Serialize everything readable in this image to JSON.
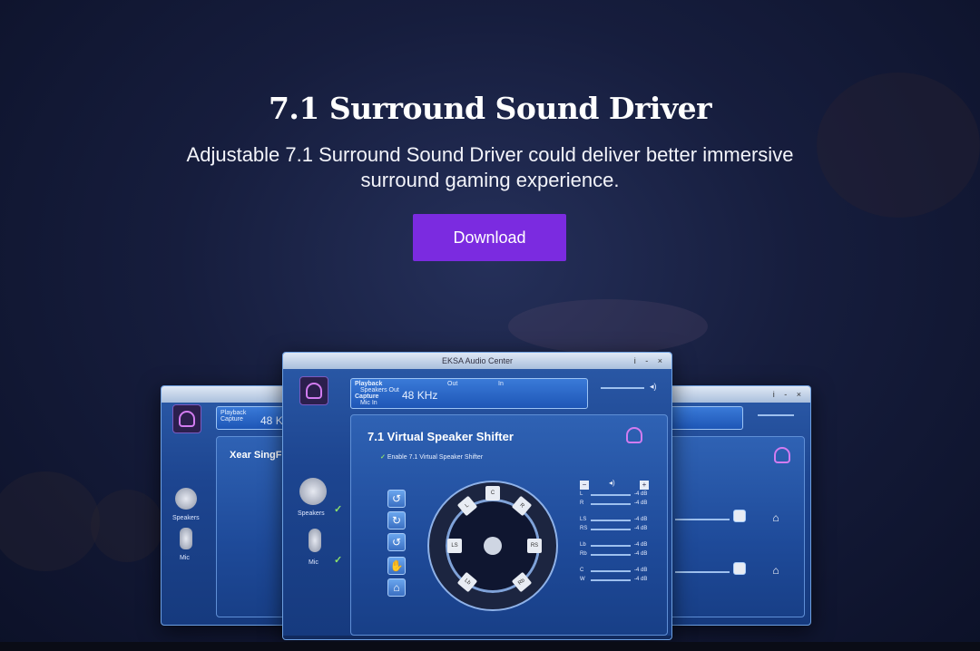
{
  "hero": {
    "title": "7.1 Surround Sound Driver",
    "subtitle": "Adjustable 7.1 Surround Sound Driver could deliver better immersive surround gaming experience.",
    "download_label": "Download"
  },
  "app": {
    "window_title": "EKSA Audio Center",
    "window_controls": "i - ×",
    "status": {
      "playback": "Playback",
      "speakers_out": "Speakers Out",
      "capture": "Capture",
      "mic_in": "Mic In",
      "rate": "48",
      "unit": "KHz",
      "out": "Out",
      "in": "In"
    },
    "left_window": {
      "rate": "48",
      "unit": "KH",
      "panel_title": "Xear SingF"
    },
    "sidebar": [
      {
        "label": "Speakers"
      },
      {
        "label": "Mic"
      }
    ],
    "shifter": {
      "title": "7.1 Virtual Speaker Shifter",
      "enable_label": "Enable 7.1 Virtual Speaker Shifter"
    },
    "speakers": [
      "C",
      "L",
      "R",
      "LS",
      "RS",
      "Lb",
      "Rb",
      "W"
    ],
    "levels": [
      {
        "ch": "L",
        "db": "-4 dB"
      },
      {
        "ch": "R",
        "db": "-4 dB"
      },
      {
        "ch": "LS",
        "db": "-4 dB"
      },
      {
        "ch": "RS",
        "db": "-4 dB"
      },
      {
        "ch": "Lb",
        "db": "-4 dB"
      },
      {
        "ch": "Rb",
        "db": "-4 dB"
      },
      {
        "ch": "C",
        "db": "-4 dB"
      },
      {
        "ch": "W",
        "db": "-4 dB"
      }
    ]
  },
  "colors": {
    "accent": "#7b2be0",
    "window_blue": "#1d4590",
    "background": "#161d3d"
  }
}
